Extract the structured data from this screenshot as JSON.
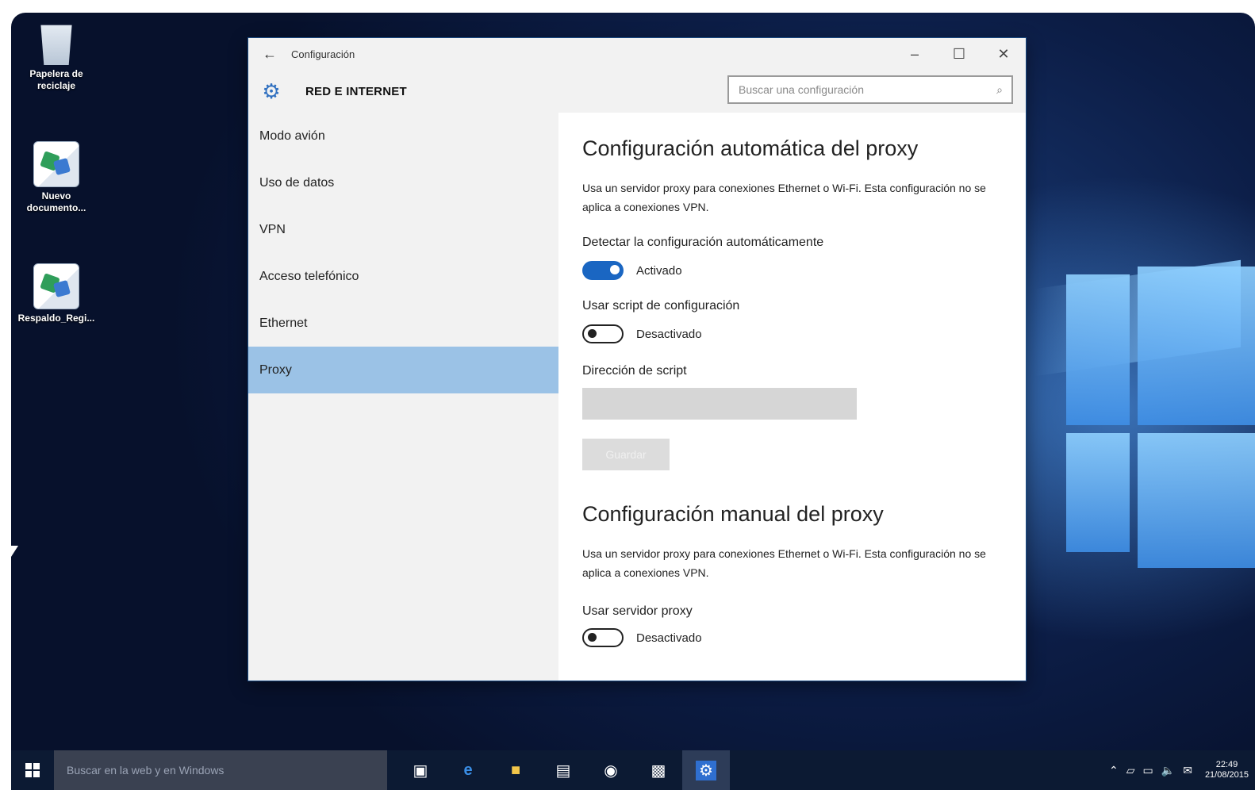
{
  "desktop": {
    "icons": [
      {
        "label": "Papelera de reciclaje"
      },
      {
        "label": "Nuevo documento..."
      },
      {
        "label": "Respaldo_Regi..."
      }
    ]
  },
  "window": {
    "title": "Configuración",
    "section_title": "RED E INTERNET",
    "search_placeholder": "Buscar una configuración"
  },
  "nav": {
    "items": [
      {
        "label": "Modo avión"
      },
      {
        "label": "Uso de datos"
      },
      {
        "label": "VPN"
      },
      {
        "label": "Acceso telefónico"
      },
      {
        "label": "Ethernet"
      },
      {
        "label": "Proxy"
      }
    ],
    "active": "Proxy"
  },
  "content": {
    "auto": {
      "heading": "Configuración automática del proxy",
      "description": "Usa un servidor proxy para conexiones Ethernet o Wi-Fi. Esta configuración no se aplica a conexiones VPN.",
      "detect_label": "Detectar la configuración automáticamente",
      "detect_state": "Activado",
      "script_label": "Usar script de configuración",
      "script_state": "Desactivado",
      "address_label": "Dirección de script",
      "save_label": "Guardar"
    },
    "manual": {
      "heading": "Configuración manual del proxy",
      "description": "Usa un servidor proxy para conexiones Ethernet o Wi-Fi. Esta configuración no se aplica a conexiones VPN.",
      "use_label": "Usar servidor proxy",
      "use_state": "Desactivado"
    }
  },
  "taskbar": {
    "search_placeholder": "Buscar en la web y en Windows",
    "clock_time": "22:49",
    "clock_date": "21/08/2015"
  },
  "colors": {
    "accent": "#1a66c2",
    "nav_active": "#9bc2e6"
  }
}
